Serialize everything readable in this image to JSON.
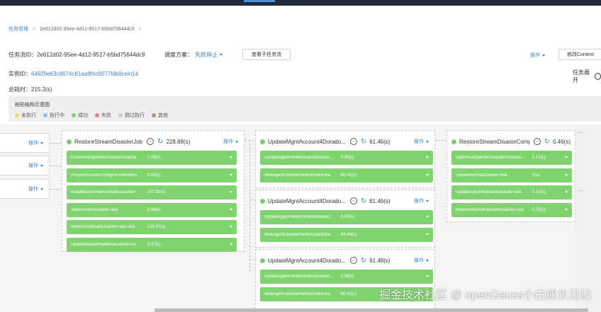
{
  "breadcrumb": {
    "root": "任务管理",
    "separator": ">",
    "current": "2e612d02-95ee-4d12-9517-b5bd75644dc9",
    "tail_sep": ">"
  },
  "header": {
    "flow_label": "任务流ID：",
    "flow_id": "2e612d02-95ee-4d12-9517-b5bd75644dc9",
    "schedule_label": "调度方案：",
    "schedule_value": "失败停止",
    "view_subflow": "查看子任务流",
    "ops": "操作",
    "modify_context": "修改Context",
    "instance_label": "实例ID：",
    "instance_id": "64929e63c8674c81aa9f4c6077fdb8cein14",
    "expand_label": "任务展开",
    "elapsed": "总耗时：215.2(s)"
  },
  "legend": {
    "title": "树形结构示意图",
    "items": [
      {
        "label": "未执行",
        "color": "#e8e25a"
      },
      {
        "label": "执行中",
        "color": "#7fc3e8"
      },
      {
        "label": "成功",
        "color": "#80d46f"
      },
      {
        "label": "失败",
        "color": "#f08080"
      },
      {
        "label": "跳过执行",
        "color": "#cccccc"
      },
      {
        "label": "其他",
        "color": "#b0966a"
      }
    ]
  },
  "stubs": [
    {
      "op": "操作"
    },
    {
      "op": "操作"
    },
    {
      "op": "操作"
    }
  ],
  "jobs": [
    {
      "name": "RestoreStreamDisasterJob",
      "collapse": "-",
      "duration": "228.88(s)",
      "op": "操作",
      "tasks": [
        {
          "name": "CloseHa4OperateDisasterInstance",
          "dur": "1.09(s)"
        },
        {
          "name": "ProcessClusterConfiginfos4BuildDi",
          "dur": "0.04(s)"
        },
        {
          "name": "ReadMasterPwd4StreamDisasterT",
          "dur": "107.56(s)"
        },
        {
          "name": "StartStreamDisasterTask",
          "dur": "8.98(s)"
        },
        {
          "name": "WaitStartStreamDisasterTaskTask",
          "dur": "128.67(s)"
        },
        {
          "name": "UpdateMasterPwdMetaData4Dora",
          "dur": "0.37(s)"
        }
      ]
    },
    {
      "name": "UpdateMgntAccount4Dorado...",
      "collapse": "-",
      "duration": "61.46(s)",
      "op": "操作",
      "tasks": [
        {
          "name": "UpdateAgentPwd4DoradoDisaster...",
          "dur": "0.40(s)"
        },
        {
          "name": "WaitAgentUpdatePwd4DoradoDisa",
          "dur": "60.41(s)"
        }
      ]
    },
    {
      "name": "UpdateMgntAccount4Dorado...",
      "collapse": "-",
      "duration": "61.46(s)",
      "op": "操作",
      "tasks": [
        {
          "name": "UpdateAgentPwd4DoradoDisaster...",
          "dur": "0.42(s)"
        },
        {
          "name": "WaitAgentUpdatePwd4DoradoDisa",
          "dur": "60.44(s)"
        }
      ]
    },
    {
      "name": "UpdateMgntAccount4Dorado...",
      "collapse": "-",
      "duration": "61.48(s)",
      "op": "操作",
      "tasks": [
        {
          "name": "UpdateAgentPwd4DoradoDisaster...",
          "dur": "0.48(s)"
        },
        {
          "name": "WaitAgentUpdatePwd4DoradoDisa",
          "dur": "60.42(s)"
        }
      ]
    },
    {
      "name": "RestoreStreamDisasteComp...",
      "collapse": "-",
      "duration": "0.46(s)",
      "op": "",
      "tasks": [
        {
          "name": "OpenHa4OperateDisasterInstance...",
          "dur": "1.12(s)"
        },
        {
          "name": "UpdateNormalDisasterTask",
          "dur": "0(s)"
        },
        {
          "name": "UpdateAction4StreamDisasterTask",
          "dur": "0.13(s)"
        },
        {
          "name": "RestoreAlarm4OperateDisasterTask",
          "dur": "0.25(s)"
        }
      ]
    }
  ],
  "watermark": "掘金技术社区 @ openGauss小白成长日记",
  "colors": {
    "accent": "#3b82c4",
    "success": "#80d46f"
  }
}
